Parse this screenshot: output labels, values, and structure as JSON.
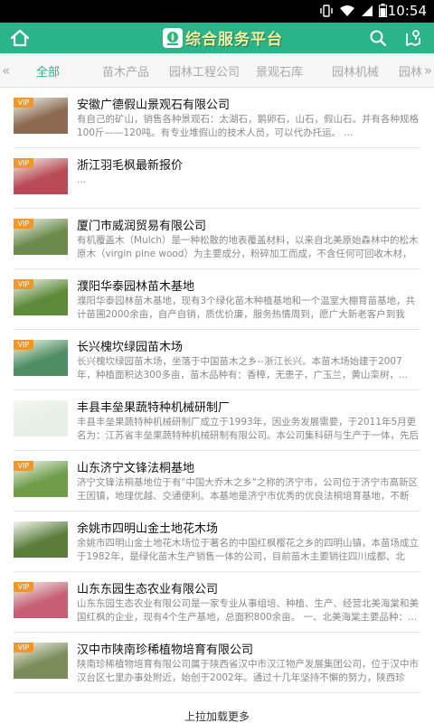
{
  "status_bar": {
    "time": "10:54"
  },
  "app": {
    "title": "综合服务平台"
  },
  "tabs": [
    {
      "label": "全部",
      "active": true
    },
    {
      "label": "苗木产品",
      "active": false
    },
    {
      "label": "园林工程公司",
      "active": false
    },
    {
      "label": "景观石库",
      "active": false
    },
    {
      "label": "园林机械",
      "active": false
    },
    {
      "label": "园林",
      "active": false
    }
  ],
  "items": [
    {
      "title": "安徽广德假山景观石有限公司",
      "desc": "有自己的矿山，销售各种景观石：太湖石，鹅卵石，山石，假山石。并有各种规格100斤——120吨。有专业堆假山的技术人员，可以代办托运。 ...",
      "vip": true,
      "pic": "#8c6a52"
    },
    {
      "title": "浙江羽毛枫最新报价",
      "desc": "...",
      "vip": true,
      "pic": "#b84b55"
    },
    {
      "title": "厦门市威润贸易有限公司",
      "desc": "有机覆盖木（Mulch）是一种松散的地表覆盖材料，以来自北美原始森林中的松木原木（virgin pine wood）为主要成分，粉碎加工而成，不含任何可回收木材，保证...",
      "vip": true,
      "pic": "#6b8a4c"
    },
    {
      "title": "濮阳华泰园林苗木基地",
      "desc": "濮阳华泰园林苗木基地，现有3个绿化苗木种植基地和一个温室大棚育苗基地，共计苗圃2000余亩，自产自销，质优价廉，服务热情周到，愿广大新老客户到我公...",
      "vip": true,
      "pic": "#5e8a3a"
    },
    {
      "title": "长兴槐坎绿园苗木场",
      "desc": "长兴槐坎绿园苗木场，坐落于中国苗木之乡--浙江长兴。本苗木场始建于2007年，种植面积达300多亩，苗木品种有：香樟，无患子，广玉兰，黄山栾树，...",
      "vip": true,
      "pic": "#4f8e64"
    },
    {
      "title": "丰县丰垒果蔬特种机械研制厂",
      "desc": "丰县丰垒果蔬特种机械研制厂成立于1993年，因业务发展需要，于2011年5月更名为：江苏省丰垒果蔬特种机械研制有限公司。本公司集科研与生产于一体，先后承...",
      "vip": false,
      "pic": "#e8efe4"
    },
    {
      "title": "山东济宁文锋法桐基地",
      "desc": "济宁文锋法桐基地位于有\"中国大乔木之乡\"之称的济宁市，公司位于济宁市高新区王因镇，地理优越、交通便利。本基地是济宁市优秀的优良法桐培育基地，不断发...",
      "vip": true,
      "pic": "#6f9d4a"
    },
    {
      "title": "余姚市四明山金土地花木场",
      "desc": "余姚市四明山金土地花木场位于著名的中国红枫樱花之乡的四明山镇，本苗场成立于1982年，是绿化苗木生产销售一体的公司，目前苗木主要销往四川成都、北京...",
      "vip": false,
      "pic": "#5a7d3c"
    },
    {
      "title": "山东东园生态农业有限公司",
      "desc": "山东东园生态农业有限公司是一家专业从事组培、种植、生产、经营北美海棠和美国红枫的企业，现有4个生产基地，总面积800余亩。 一、北美海棠主要品种：...",
      "vip": true,
      "pic": "#c65f73"
    },
    {
      "title": "汉中市陕南珍稀植物培育有限公司",
      "desc": "陕南珍稀植物培育有限公司属于陕西省汉中市汉江物产发展集团公司，位于汉中市汉台区七里办事处附近，始创于2002年。通过十几年坚持不懈的努力，陕西珍稀...",
      "vip": true,
      "pic": "#7a8c58"
    }
  ],
  "footer": {
    "load_more": "上拉加载更多"
  }
}
